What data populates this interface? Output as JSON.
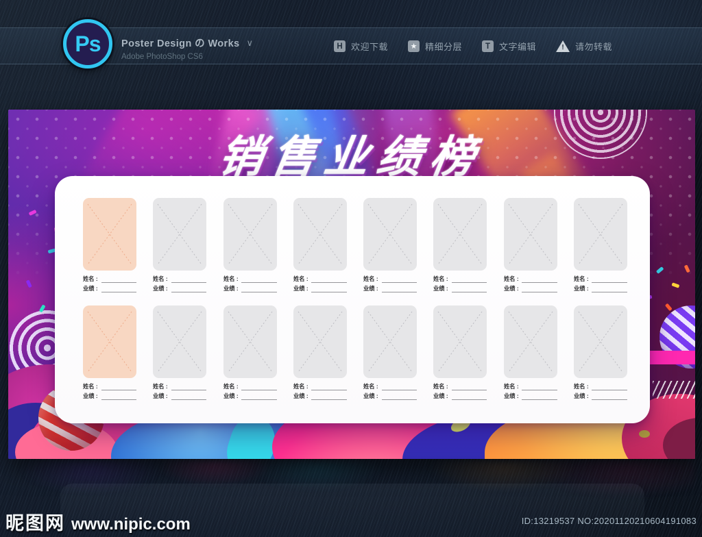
{
  "header": {
    "logo_text": "Ps",
    "title": "Poster Design の Works",
    "dropdown_caret": "∨",
    "subtitle": "Adobe PhotoShop CS6",
    "badges": [
      {
        "icon_glyph": "H",
        "label": "欢迎下载"
      },
      {
        "icon_glyph": "★",
        "label": "精细分层"
      },
      {
        "icon_glyph": "T",
        "label": "文字编辑"
      },
      {
        "icon_glyph": "!",
        "label": "请勿转载"
      }
    ]
  },
  "poster": {
    "title": "销售业绩榜",
    "grid": {
      "rows": 2,
      "cols": 8,
      "highlight_column": 0,
      "name_label": "姓名 :",
      "score_label": "业绩 :"
    }
  },
  "footer": {
    "site_name": "昵图网",
    "site_url": "www.nipic.com",
    "image_id": "ID:13219537 NO:20201120210604191083"
  },
  "colors": {
    "accent_cyan": "#31c6f1",
    "poster_purple": "#5a2fae",
    "poster_magenta": "#ff2e9a",
    "poster_orange": "#ffa244",
    "poster_blue": "#2e6fd6",
    "frame_gray": "#e6e6e8",
    "frame_peach": "#f8d7c2",
    "card_white": "#ffffff"
  }
}
